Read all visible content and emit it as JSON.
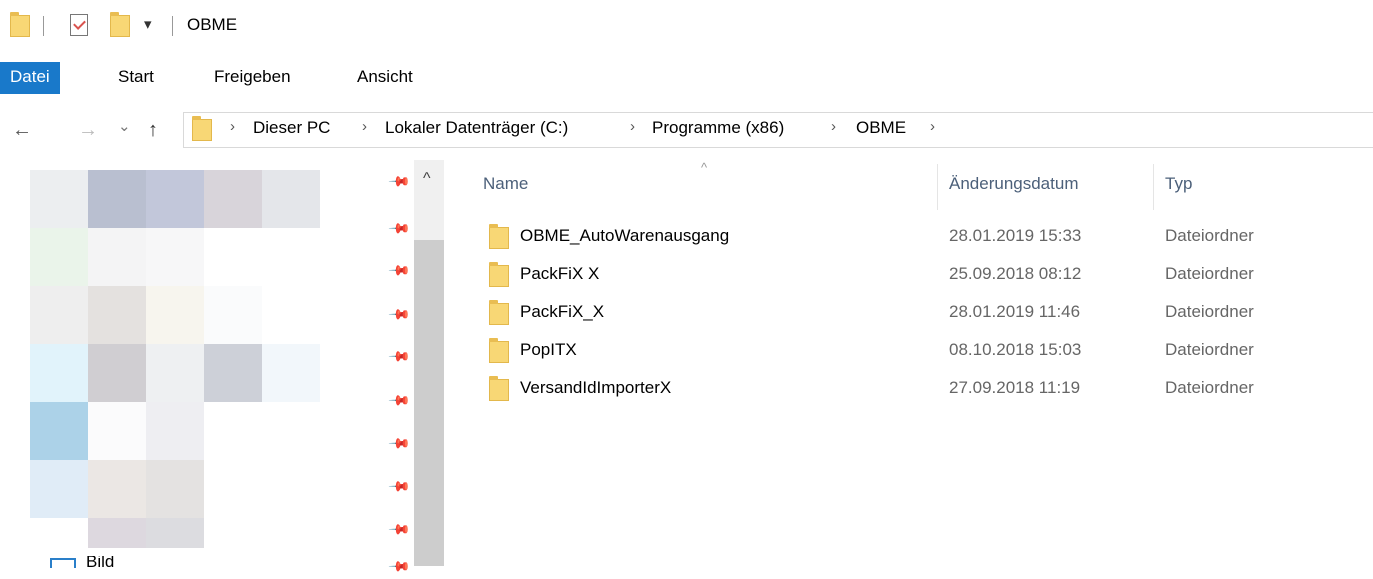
{
  "window": {
    "title": "OBME"
  },
  "quick_access": {
    "dropdown_glyph": "▾"
  },
  "ribbon": {
    "tabs": [
      {
        "label": "Datei",
        "active": true
      },
      {
        "label": "Start",
        "active": false
      },
      {
        "label": "Freigeben",
        "active": false
      },
      {
        "label": "Ansicht",
        "active": false
      }
    ],
    "accent": "#1979ca"
  },
  "navigation": {
    "back_glyph": "←",
    "forward_glyph": "→",
    "recent_glyph": "⌄",
    "up_glyph": "↑",
    "breadcrumb": [
      "Dieser PC",
      "Lokaler Datenträger (C:)",
      "Programme (x86)",
      "OBME"
    ],
    "crumb_separator": "›"
  },
  "sidebar": {
    "partial_item_label": "Bild",
    "pin_glyph": "📌",
    "scroll_up_glyph": "^"
  },
  "columns": {
    "sort_glyph": "^",
    "name": "Name",
    "date": "Änderungsdatum",
    "type": "Typ"
  },
  "files": [
    {
      "name": "OBME_AutoWarenausgang",
      "date": "28.01.2019 15:33",
      "type": "Dateiordner"
    },
    {
      "name": "PackFiX X",
      "date": "25.09.2018 08:12",
      "type": "Dateiordner"
    },
    {
      "name": "PackFiX_X",
      "date": "28.01.2019 11:46",
      "type": "Dateiordner"
    },
    {
      "name": "PopITX",
      "date": "08.10.2018 15:03",
      "type": "Dateiordner"
    },
    {
      "name": "VersandIdImporterX",
      "date": "27.09.2018 11:19",
      "type": "Dateiordner"
    }
  ]
}
